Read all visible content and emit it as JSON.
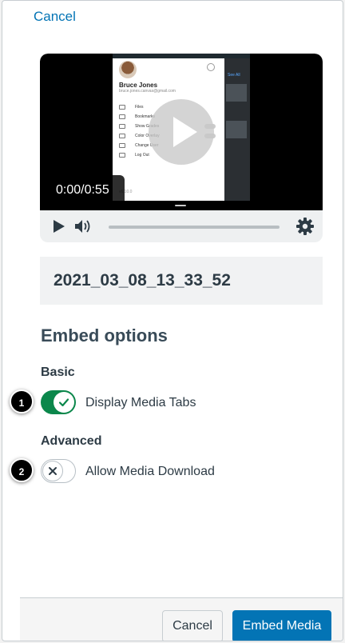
{
  "header": {
    "cancel_link": "Cancel"
  },
  "player": {
    "timecode": "0:00/0:55",
    "video_frame": {
      "user_name": "Bruce Jones",
      "user_email": "bruce.jones.canvas@gmail.com",
      "menu_items": [
        "Files",
        "Bookmarks",
        "Show Grades",
        "Color Overlay",
        "Change User",
        "Log Out"
      ],
      "version": "v6.10.0",
      "side_link": "See All"
    },
    "progress_fraction": 0
  },
  "media": {
    "title": "2021_03_08_13_33_52"
  },
  "embed": {
    "heading": "Embed options",
    "basic": {
      "label": "Basic",
      "option_label": "Display Media Tabs",
      "checked": true
    },
    "advanced": {
      "label": "Advanced",
      "option_label": "Allow Media Download",
      "checked": false
    }
  },
  "callouts": [
    "1",
    "2"
  ],
  "footer": {
    "cancel_label": "Cancel",
    "embed_label": "Embed Media"
  },
  "colors": {
    "link": "#0374b5",
    "toggle_on": "#0b874b",
    "primary_button": "#0374b5",
    "text": "#2d3b45"
  }
}
